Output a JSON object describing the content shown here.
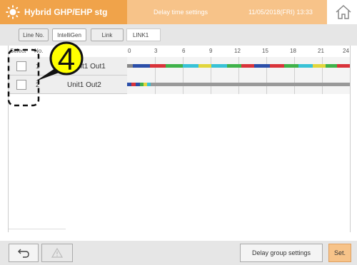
{
  "header": {
    "title": "Hybrid GHP/EHP stg",
    "screen_name": "Delay time settings",
    "datetime": "11/05/2018(FRI) 13:33",
    "accent": "#f0a34a",
    "accent_light": "#f7c389"
  },
  "toolbar": {
    "line_no_label": "Line No.",
    "intelligen_label": "IntelliGen",
    "link_label": "Link",
    "link_value": "LINK1"
  },
  "grid": {
    "col_select": "Select",
    "col_no": "No.",
    "time_ticks": [
      "0",
      "3",
      "6",
      "9",
      "12",
      "15",
      "18",
      "21",
      "24"
    ],
    "rows": [
      {
        "no": "1",
        "name": "Unit1 Out1",
        "selected": false
      },
      {
        "no": "2",
        "name": "Unit1 Out2",
        "selected": false
      }
    ]
  },
  "callout": {
    "number": "4",
    "fill": "#ffff00"
  },
  "footer": {
    "back_icon": "back-arrow-icon",
    "warning_icon": "warning-icon",
    "delay_group_label": "Delay group settings",
    "set_label": "Set."
  }
}
